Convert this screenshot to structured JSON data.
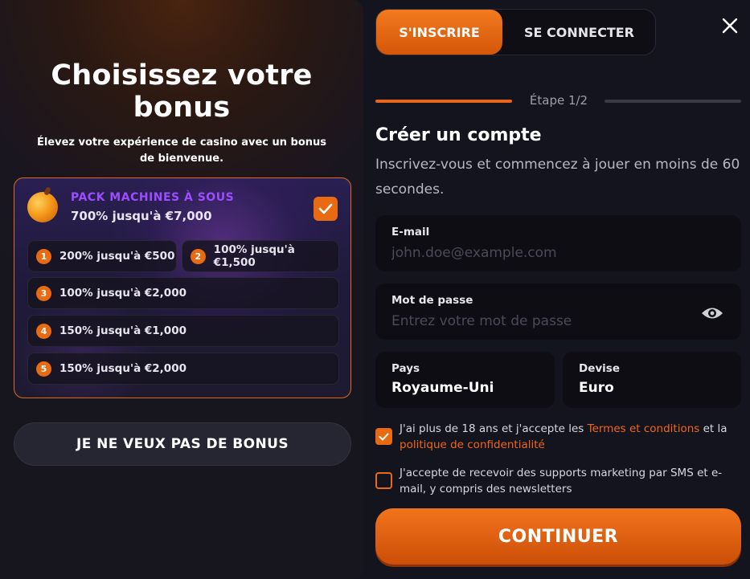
{
  "left": {
    "title": "Choisissez votre bonus",
    "subtitle": "Élevez votre expérience de casino avec un bonus de bienvenue.",
    "pack": {
      "title": "PACK MACHINES À SOUS",
      "amount": "700% jusqu'à €7,000",
      "selected": true
    },
    "bonuses": [
      {
        "num": "1",
        "label": "200% jusqu'à €500"
      },
      {
        "num": "2",
        "label": "100% jusqu'à €1,500"
      },
      {
        "num": "3",
        "label": "100% jusqu'à €2,000"
      },
      {
        "num": "4",
        "label": "150% jusqu'à €1,000"
      },
      {
        "num": "5",
        "label": "150% jusqu'à €2,000"
      }
    ],
    "no_bonus_label": "JE NE VEUX PAS DE BONUS"
  },
  "tabs": {
    "signup": "S'INSCRIRE",
    "login": "SE CONNECTER"
  },
  "step": {
    "label": "Étape 1/2",
    "current": 1,
    "total": 2
  },
  "form": {
    "title": "Créer un compte",
    "subtitle": "Inscrivez-vous et commencez à jouer en moins de 60 secondes.",
    "email": {
      "label": "E-mail",
      "placeholder": "john.doe@example.com"
    },
    "password": {
      "label": "Mot de passe",
      "placeholder": "Entrez votre mot de passe"
    },
    "country": {
      "label": "Pays",
      "value": "Royaume-Uni"
    },
    "currency": {
      "label": "Devise",
      "value": "Euro"
    },
    "terms": {
      "checked": true,
      "prefix": "J'ai plus de 18 ans et j'accepte les ",
      "terms_link": "Termes et conditions",
      "middle": " et la",
      "privacy_link": "politique de confidentialité"
    },
    "marketing": {
      "checked": false,
      "text": "J'accepte de recevoir des supports marketing par SMS et e-mail, y compris des newsletters"
    },
    "continue_label": "CONTINUER"
  },
  "colors": {
    "accent": "#e86a12",
    "pack_title": "#9b4dff",
    "background": "#14141f"
  },
  "icons": {
    "close": "close-icon",
    "eye": "eye-icon",
    "check": "check-icon",
    "fruit": "orange-fruit-icon"
  }
}
